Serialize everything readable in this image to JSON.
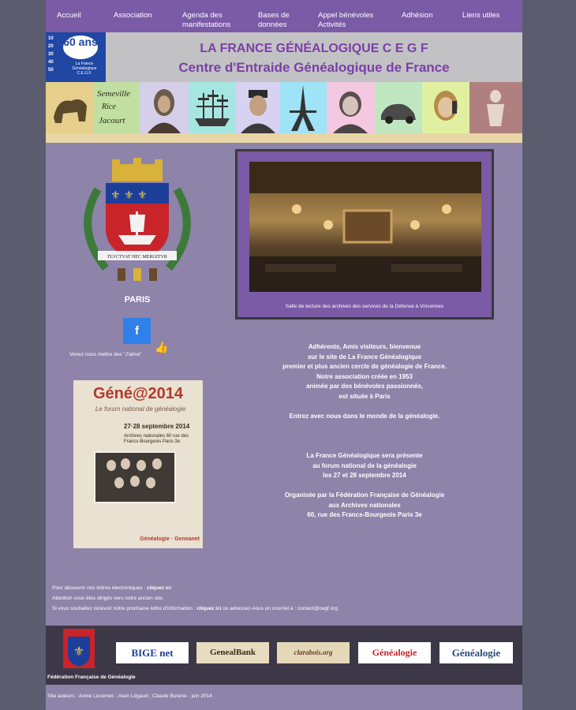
{
  "nav": {
    "items": [
      {
        "label": "Accueil"
      },
      {
        "label": "Association"
      },
      {
        "label": "Agenda des manifestations"
      },
      {
        "label": "Bases de données"
      },
      {
        "label": "Appel bénévoles Activités"
      },
      {
        "label": "Adhésion"
      },
      {
        "label": "Liens utiles"
      }
    ]
  },
  "header": {
    "logo": {
      "nums": "10\n20\n30\n40\n50",
      "badge": "60 ans",
      "sub": "La France Généalogique C.E.G.F."
    },
    "title": "LA FRANCE GÉNÉALOGIQUE C E G F",
    "subtitle": "Centre d'Entraide Généalogique de France"
  },
  "strip": {
    "colors": [
      "#e6cf8a",
      "#c1dfa0",
      "#d5cfe9",
      "#a6e6e1",
      "#d7d2f2",
      "#9fe3f6",
      "#f3c8e0",
      "#bfe7c0",
      "#e1f0a0",
      "#b08080"
    ],
    "tile_text": [
      "",
      "Semeville · Rice · Jacourt",
      "",
      "",
      "",
      "",
      "",
      "",
      "",
      ""
    ]
  },
  "left": {
    "paris_label": "PARIS",
    "fb_label": "f",
    "fb_text": "Venez nous mettre des \"J'aime\"",
    "motto": "FLVCTVAT NEC MERGITVR"
  },
  "photo": {
    "caption": "Salle de lecture des archives des services de la Défense à Vincennes"
  },
  "welcome": {
    "lines": [
      "Adhérents, Amis visiteurs, bienvenue",
      "sur le site de La France Généalogique",
      "premier et plus ancien cercle de généalogie de France.",
      "Notre association créée en 1953",
      "animée par des bénévoles passionnés,",
      "est située à Paris",
      "",
      "Entrez avec nous dans le monde de la généalogie."
    ]
  },
  "poster": {
    "title": "Géné@2014",
    "subtitle": "Le forum national de généalogie",
    "dates": "27·28 septembre 2014",
    "place": "Archives nationales 60 rue des Francs-Bourgeois Paris 3e",
    "sponsors": "Généalogie · Geneanet"
  },
  "announce": {
    "lines": [
      "La France Généalogique sera présente",
      "au forum national de la généalogie",
      "les 27 et 28 septembre 2014",
      "",
      "Organisée par la Fédération Française de Généalogie",
      "aux Archives nationales",
      "60, rue des Francs-Bourgeois Paris 3e"
    ]
  },
  "footnotes": {
    "line1_text": "Pour découvrir nos lettres électroniques : ",
    "line1_link": "cliquez ici",
    "line2": "Attention vous êtes dirigés vers notre ancien site.",
    "line3_text": "Si vous souhaitez recevoir notre prochaine lettre d'information : ",
    "line3_link": "cliquez ici",
    "line3_rest": " ou adressez-nous un courriel à : contact@cegf.org"
  },
  "partners": {
    "ffg_label": "Fédération Française de Généalogie",
    "logos": [
      "BIGE net",
      "GenealBank",
      "clarabois.org",
      "Généalogie",
      "Généalogie"
    ]
  },
  "credits": "Site auteurs : Annie Lecomec ; Alain Légaud ; Claude Buisine - juin 2014"
}
